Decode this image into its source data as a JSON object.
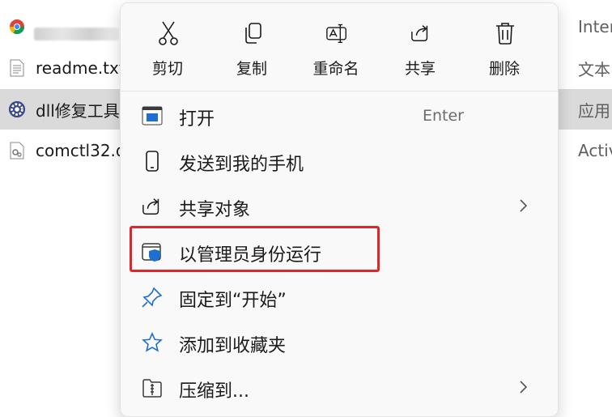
{
  "explorer": {
    "files": [
      {
        "name": "",
        "icon": "chrome-icon",
        "blurred": true
      },
      {
        "name": "readme.txt",
        "icon": "text-file-icon"
      },
      {
        "name": "dll修复工具",
        "icon": "app-gear-icon",
        "selected": true
      },
      {
        "name": "comctl32.d",
        "icon": "dll-file-icon"
      }
    ],
    "types": [
      "Inter",
      "文本",
      "应用",
      "Activ"
    ]
  },
  "context_menu": {
    "quick_actions": [
      {
        "label": "剪切",
        "icon": "scissors-icon"
      },
      {
        "label": "复制",
        "icon": "copy-icon"
      },
      {
        "label": "重命名",
        "icon": "rename-icon"
      },
      {
        "label": "共享",
        "icon": "share-icon"
      },
      {
        "label": "删除",
        "icon": "trash-icon"
      }
    ],
    "items": [
      {
        "label": "打开",
        "shortcut": "Enter",
        "icon": "app-window-icon"
      },
      {
        "label": "发送到我的手机",
        "icon": "phone-icon"
      },
      {
        "label": "共享对象",
        "icon": "share-icon",
        "submenu": true
      },
      {
        "label": "以管理员身份运行",
        "icon": "shield-icon",
        "highlighted": true
      },
      {
        "label": "固定到“开始”",
        "icon": "pin-icon"
      },
      {
        "label": "添加到收藏夹",
        "icon": "star-icon"
      },
      {
        "label": "压缩到...",
        "icon": "zip-folder-icon",
        "submenu": true
      }
    ]
  },
  "colors": {
    "accent": "#1a5fb4",
    "highlight_border": "#e0262b",
    "selection": "#dadada"
  }
}
